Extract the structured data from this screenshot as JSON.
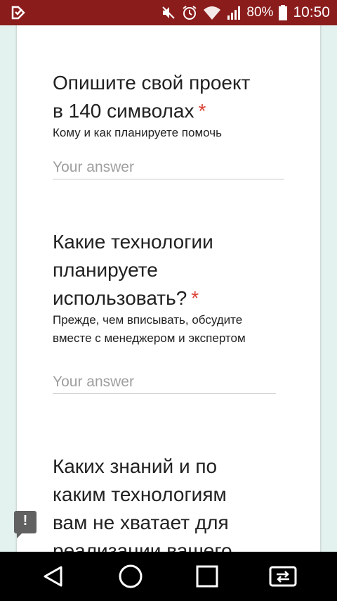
{
  "status_bar": {
    "battery": "80%",
    "time": "10:50",
    "icons": [
      "app-notification-icon",
      "mute-icon",
      "alarm-icon",
      "wifi-icon",
      "signal-icon",
      "battery-icon"
    ]
  },
  "form": {
    "questions": [
      {
        "title_lines": [
          "Опишите свой проект",
          "в 140 символах"
        ],
        "required_mark": "*",
        "help": "Кому и как планируете помочь",
        "placeholder": "Your answer"
      },
      {
        "title_lines": [
          "Какие технологии",
          "планируете",
          "использовать?"
        ],
        "required_mark": "*",
        "help_lines": [
          "Прежде, чем вписывать, обсудите",
          "вместе с менеджером и экспертом"
        ],
        "placeholder": "Your answer"
      },
      {
        "title_lines": [
          "Каких знаний и по",
          "каким технологиям",
          "вам не хватает для",
          "реализации вашего"
        ]
      }
    ]
  },
  "feedback": {
    "label": "!"
  },
  "nav_bar": {
    "buttons": [
      "back-icon",
      "home-icon",
      "recents-icon",
      "screen-mirror-icon"
    ]
  },
  "colors": {
    "status_bar": "#8b1c1c",
    "background": "#e3f1ef",
    "required": "#db4437",
    "text": "#212121",
    "placeholder": "#9e9e9e"
  }
}
